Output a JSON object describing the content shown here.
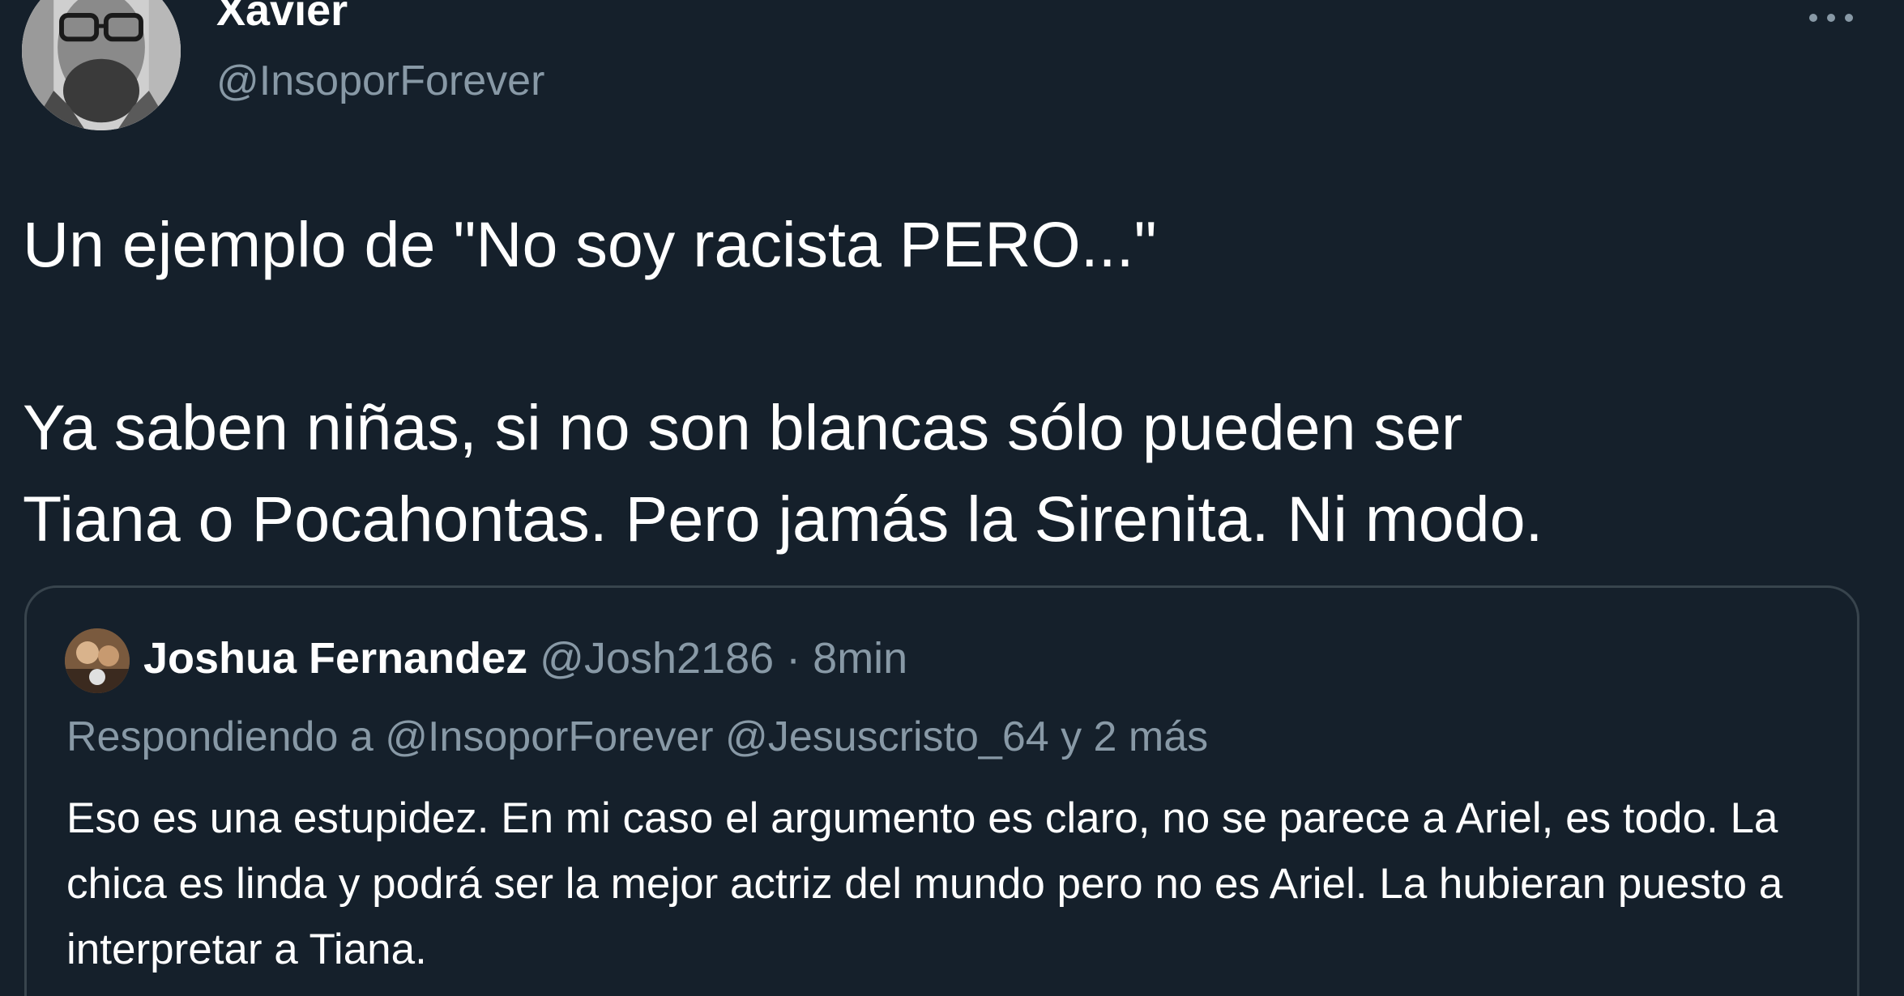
{
  "tweet": {
    "display_name": "Xavier",
    "handle": "@InsoporForever",
    "more_icon": "more-horizontal-icon",
    "text_line_1": "Un ejemplo de \"No soy racista PERO...\"",
    "text_line_2": "Ya saben niñas, si no son blancas sólo pueden ser\nTiana o Pocahontas. Pero jamás la Sirenita. Ni modo."
  },
  "quoted_tweet": {
    "display_name": "Joshua Fernandez",
    "handle": "@Josh2186",
    "separator": "·",
    "time": "8min",
    "replying_to": "Respondiendo a @InsoporForever @Jesuscristo_64 y 2 más",
    "text": "Eso es una estupidez. En mi caso el argumento es claro, no se parece a Ariel, es todo. La chica es linda y podrá ser la mejor actriz del mundo pero no es Ariel. La hubieran puesto a interpretar a Tiana."
  },
  "colors": {
    "background": "#15202b",
    "primary_text": "#ffffff",
    "secondary_text": "#8899a6",
    "border": "#38444d"
  }
}
